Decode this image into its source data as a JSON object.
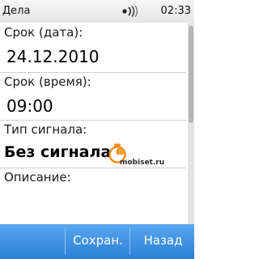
{
  "status_bar": {
    "title": "Дела",
    "time": "02:33",
    "signal_icon": "broadcast-signal-icon"
  },
  "fields": {
    "date_label": "Срок (дата):",
    "date_value": "24.12.2010",
    "time_label": "Срок (время):",
    "time_value": "09:00",
    "alarm_label": "Тип сигнала:",
    "alarm_value": "Без сигнала",
    "description_label": "Описание:"
  },
  "watermark": "mobiset.ru",
  "softkeys": {
    "save": "Сохран.",
    "back": "Назад"
  },
  "colors": {
    "softkey_bar": "#3a8fe0",
    "alarm_icon": "#f28a1a"
  }
}
